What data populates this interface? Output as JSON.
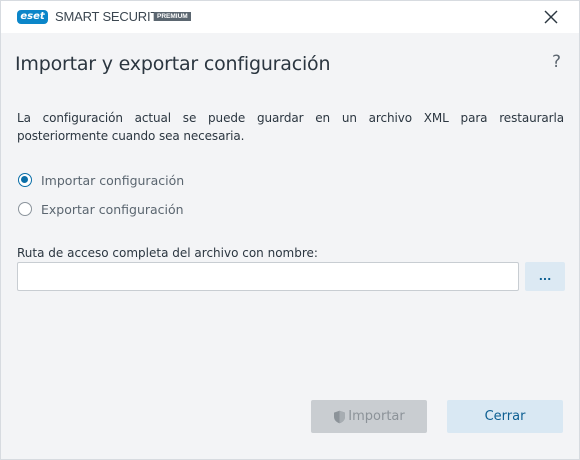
{
  "titlebar": {
    "logo_text": "eset",
    "product_name": "SMART SECURITY",
    "edition": "PREMIUM",
    "close_icon": "close-icon"
  },
  "dialog": {
    "title": "Importar y exportar configuración",
    "help_label": "?",
    "description": "La configuración actual se puede guardar en un archivo XML para restaurarla posteriormente cuando sea necesaria.",
    "options": [
      {
        "label": "Importar configuración",
        "selected": true
      },
      {
        "label": "Exportar configuración",
        "selected": false
      }
    ],
    "path": {
      "label": "Ruta de acceso completa del archivo con nombre:",
      "value": "",
      "placeholder": "",
      "browse_label": "..."
    },
    "buttons": {
      "import_label": "Importar",
      "import_enabled": false,
      "import_icon": "shield-icon",
      "close_label": "Cerrar"
    }
  },
  "colors": {
    "brand": "#0b86c9",
    "accent": "#0b6fa8",
    "secondary_button_bg": "#d9e8f3",
    "disabled_button_bg": "#c9cdd1"
  }
}
